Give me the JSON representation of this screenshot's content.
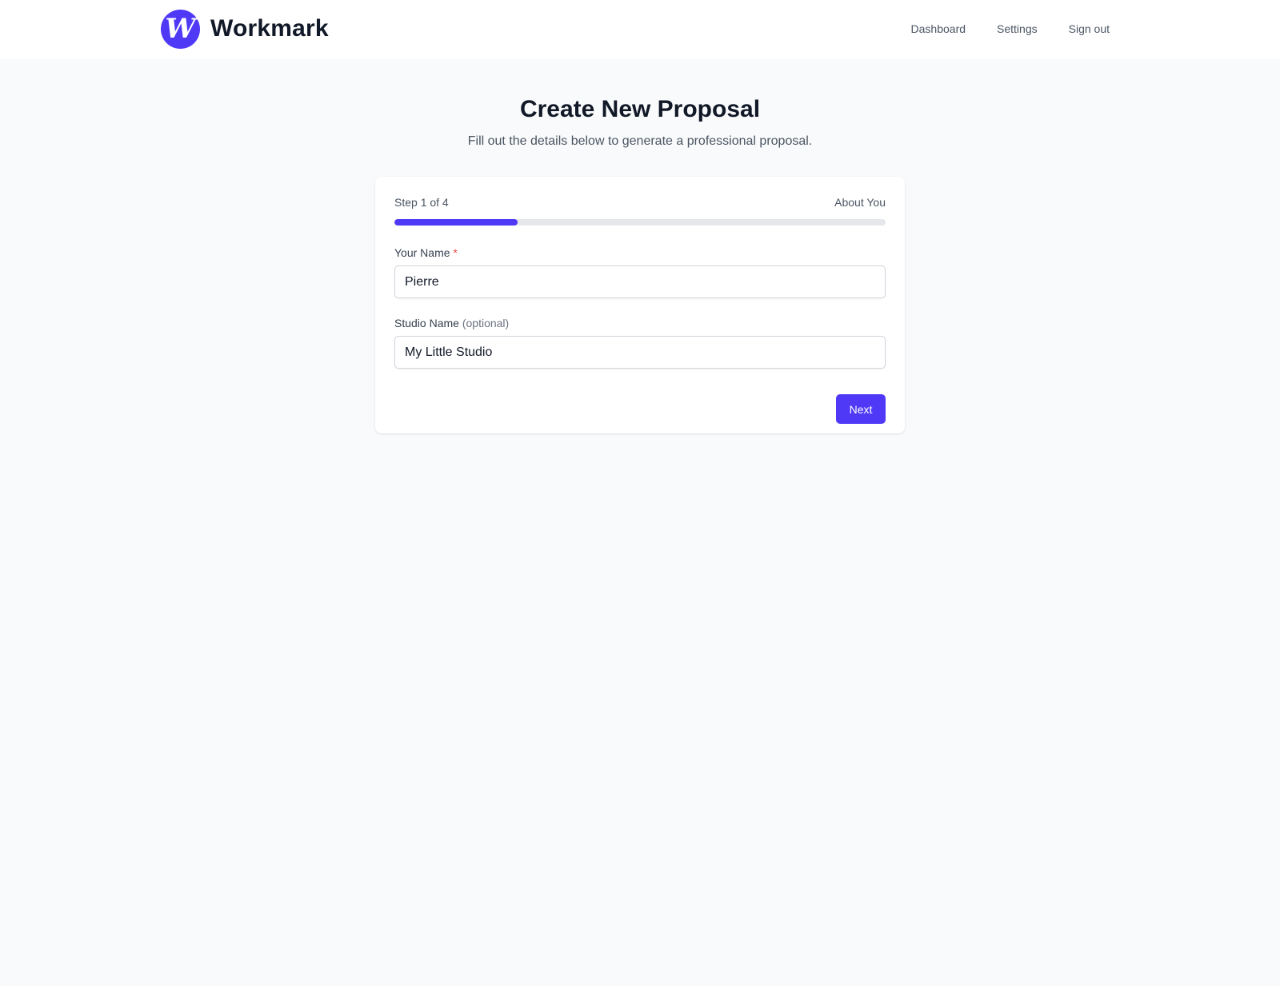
{
  "brand": {
    "logo_letter": "W",
    "name": "Workmark",
    "accent_color": "#4f39f6"
  },
  "nav": {
    "items": [
      {
        "label": "Dashboard"
      },
      {
        "label": "Settings"
      },
      {
        "label": "Sign out"
      }
    ]
  },
  "page": {
    "title": "Create New Proposal",
    "subtitle": "Fill out the details below to generate a professional proposal."
  },
  "wizard": {
    "step_text": "Step 1 of 4",
    "step_name": "About You",
    "progress_fraction": 0.25,
    "progress_color": "#4f39f6",
    "fields": {
      "name": {
        "label": "Your Name",
        "required_mark": "*",
        "value": "Pierre"
      },
      "studio": {
        "label": "Studio Name",
        "optional_note": "(optional)",
        "value": "My Little Studio"
      }
    },
    "next_label": "Next"
  }
}
